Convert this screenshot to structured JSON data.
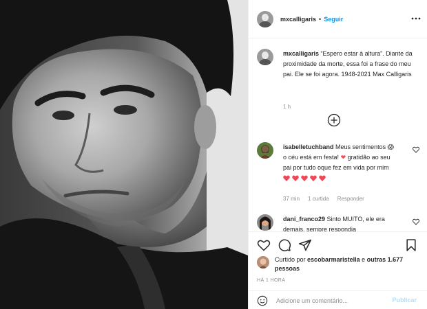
{
  "post": {
    "username": "mxcalligaris",
    "dot": "•",
    "follow_label": "Seguir",
    "caption_username": "mxcalligaris",
    "caption_text": "“Espero estar à altura”. Diante da proximidade da morte, essa foi a frase do meu pai. Ele se foi agora. 1948-2021 Max Calligaris",
    "caption_time": "1 h"
  },
  "comments": [
    {
      "username": "isabelletuchband",
      "text_part1": "Meus sentimentos",
      "emoji1": "😱",
      "text_part2": "o céu está em festa!",
      "emoji2": "❤",
      "text_part3": "gratidão ao seu pai por tudo oque fez em vida por mim",
      "hearts_count": 5,
      "time": "37 min",
      "likes": "1 curtida",
      "reply": "Responder"
    },
    {
      "username": "dani_franco29",
      "text": "Sinto MUITO, ele era demais, sempre respondia"
    }
  ],
  "liked_by": {
    "prefix": "Curtido por",
    "user": "escobarmaristella",
    "middle": "e",
    "others": "outras 1.677 pessoas"
  },
  "time_ago": "HÁ 1 HORA",
  "add_comment": {
    "placeholder": "Adicione um comentário...",
    "publish_label": "Publicar"
  },
  "colors": {
    "accent": "#0095f6",
    "publish_disabled": "#b2dffc",
    "heart_red": "#ed4956",
    "muted": "#8e8e8e"
  },
  "icons": [
    "more-icon",
    "add-circle-icon",
    "heart-icon",
    "comment-icon",
    "share-icon",
    "bookmark-icon",
    "emoji-icon"
  ]
}
